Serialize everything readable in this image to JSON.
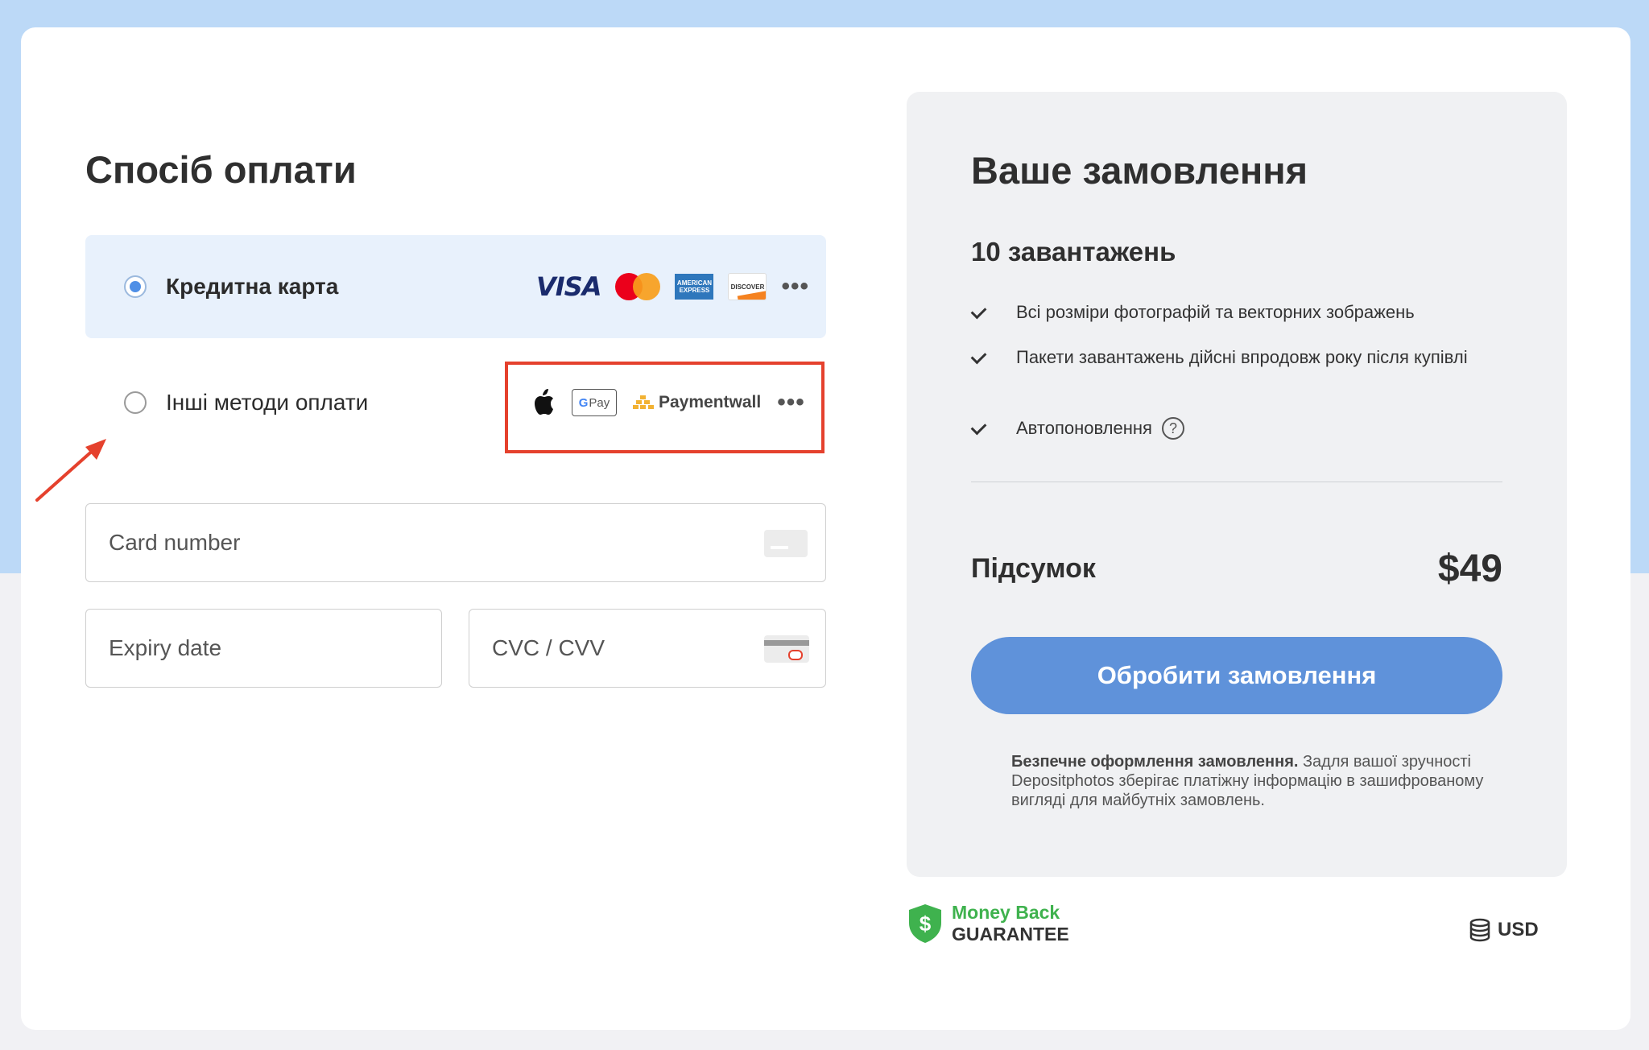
{
  "payment": {
    "title": "Спосіб оплати",
    "methods": {
      "credit": {
        "label": "Кредитна карта",
        "selected": true,
        "logos": [
          "VISA",
          "mastercard",
          "AMERICAN EXPRESS",
          "DISCOVER",
          "more-dots"
        ]
      },
      "other": {
        "label": "Інші методи оплати",
        "selected": false,
        "logos": [
          "apple-pay",
          "G Pay",
          "Paymentwall",
          "more-dots"
        ]
      }
    },
    "logo_text": {
      "visa": "VISA",
      "amex": "AMERICAN EXPRESS",
      "discover": "DISCOVER",
      "gpay_g": "G",
      "gpay_pay": "Pay",
      "paymentwall": "Paymentwall",
      "more": "•••"
    },
    "fields": {
      "card_number": {
        "placeholder": "Card number",
        "value": ""
      },
      "expiry": {
        "placeholder": "Expiry date",
        "value": ""
      },
      "cvc": {
        "placeholder": "CVC / CVV",
        "value": ""
      }
    }
  },
  "order": {
    "title": "Ваше замовлення",
    "downloads": "10 завантажень",
    "features": [
      "Всі розміри фотографій та векторних зображень",
      "Пакети завантажень дійсні впродовж року після купівлі",
      "Автопоновлення"
    ],
    "help": "?",
    "subtotal_label": "Підсумок",
    "subtotal_value": "$49",
    "process_button": "Обробити замовлення",
    "secure_bold": "Безпечне оформлення замовлення.",
    "secure_text": " Задля вашої зручності Depositphotos зберігає платіжну інформацію в зашифрованому вигляді для майбутніх замовлень."
  },
  "footer": {
    "money_back_top": "Money Back",
    "money_back_bottom": "GUARANTEE",
    "shield_symbol": "$",
    "currency": "USD"
  },
  "colors": {
    "accent": "#5f92da",
    "highlight_border": "#e5412d",
    "panel_bg": "#f0f1f3",
    "page_bg": "#bcd9f7",
    "money_back_green": "#3fb24e"
  }
}
